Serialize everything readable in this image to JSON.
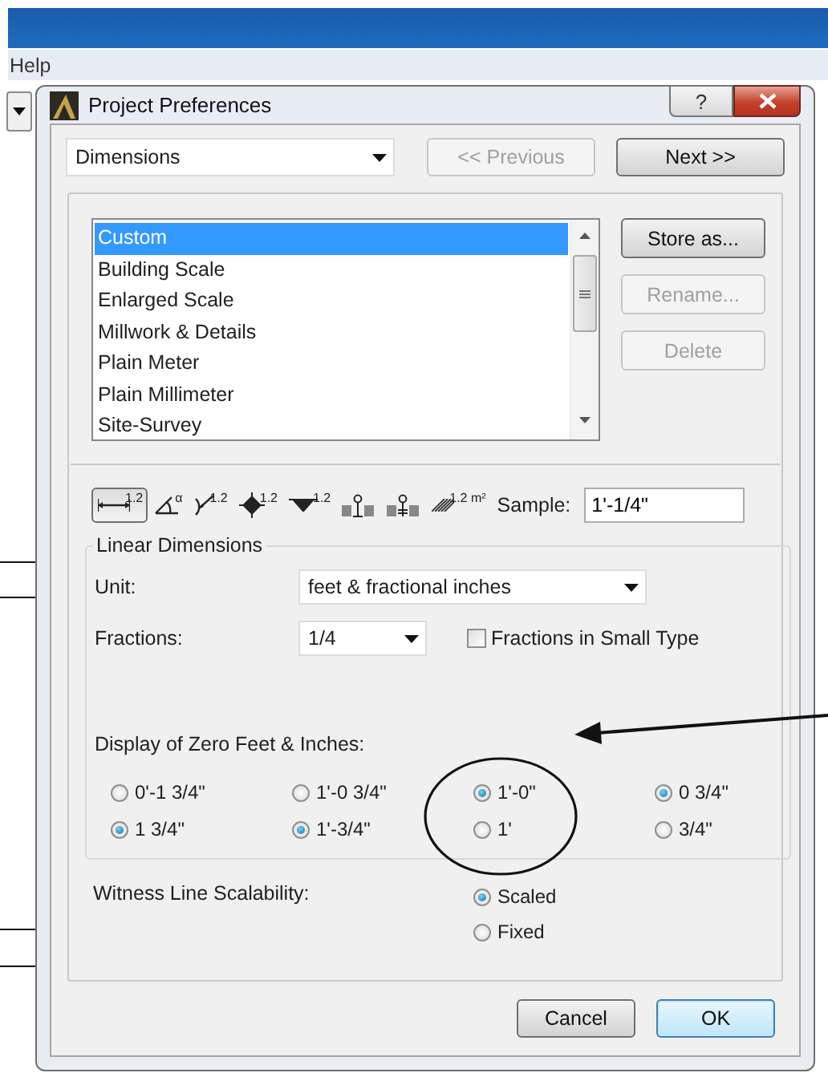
{
  "app_window": {
    "menu": [
      "Help"
    ]
  },
  "dialog": {
    "title": "Project Preferences",
    "help_button": "?",
    "page_select": {
      "value": "Dimensions"
    },
    "nav_buttons": [
      {
        "label": "<< Previous",
        "disabled": true
      },
      {
        "label": "Next >>",
        "disabled": false
      }
    ],
    "presets": [
      {
        "label": "Custom",
        "selected": true
      },
      {
        "label": "Building Scale",
        "selected": false
      },
      {
        "label": "Enlarged Scale",
        "selected": false
      },
      {
        "label": "Millwork & Details",
        "selected": false
      },
      {
        "label": "Plain Meter",
        "selected": false
      },
      {
        "label": "Plain Millimeter",
        "selected": false
      },
      {
        "label": "Site-Survey",
        "selected": false
      }
    ],
    "preset_buttons": [
      {
        "label": "Store as...",
        "disabled": false
      },
      {
        "label": "Rename...",
        "disabled": true
      },
      {
        "label": "Delete",
        "disabled": true
      }
    ],
    "dimension_types": [
      {
        "kind": "linear",
        "label": "1.2",
        "selected": true
      },
      {
        "kind": "angle",
        "label": "α",
        "selected": false
      },
      {
        "kind": "radial",
        "label": "1.2",
        "selected": false
      },
      {
        "kind": "level",
        "label": "1.2",
        "selected": false
      },
      {
        "kind": "elevation",
        "label": "1.2",
        "selected": false
      },
      {
        "kind": "door",
        "selected": false
      },
      {
        "kind": "window",
        "selected": false
      },
      {
        "kind": "area",
        "label": "1.2 m²",
        "selected": false
      }
    ],
    "sample": {
      "label": "Sample:",
      "value": "1'-1/4\""
    },
    "linear": {
      "title": "Linear Dimensions",
      "unit": {
        "label": "Unit:",
        "value": "feet & fractional inches"
      },
      "fractions": {
        "label": "Fractions:",
        "value": "1/4"
      },
      "small_type": {
        "label": "Fractions in Small Type",
        "checked": false
      },
      "zero_display": {
        "label": "Display of Zero Feet & Inches:",
        "options": [
          {
            "label": "0'-1 3/4\"",
            "selected": false
          },
          {
            "label": "1'-0 3/4\"",
            "selected": false
          },
          {
            "label": "1'-0\"",
            "selected": true
          },
          {
            "label": "0 3/4\"",
            "selected": true
          },
          {
            "label": "1 3/4\"",
            "selected": true
          },
          {
            "label": "1'-3/4\"",
            "selected": true
          },
          {
            "label": "1'",
            "selected": false
          },
          {
            "label": "3/4\"",
            "selected": false
          }
        ]
      }
    },
    "witness": {
      "label": "Witness Line Scalability:",
      "options": [
        {
          "label": "Scaled",
          "selected": true
        },
        {
          "label": "Fixed",
          "selected": false
        }
      ]
    },
    "footer_buttons": [
      {
        "label": "Cancel",
        "default": false
      },
      {
        "label": "OK",
        "default": true
      }
    ]
  }
}
